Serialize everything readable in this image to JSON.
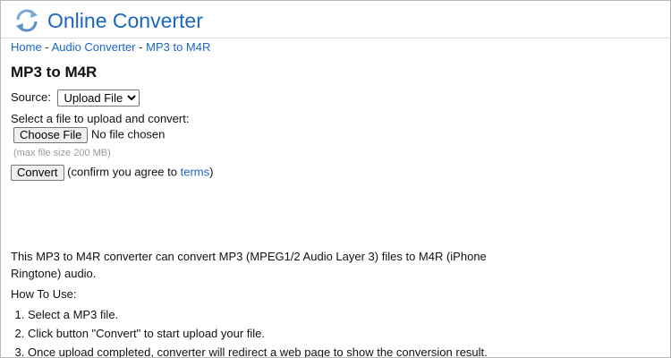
{
  "header": {
    "logo_text": "Online Converter",
    "brand_color": "#2b7fd0",
    "logo_icon": "refresh-arrows-icon"
  },
  "breadcrumb": {
    "items": [
      "Home",
      "Audio Converter",
      "MP3 to M4R"
    ],
    "separator": "-"
  },
  "page": {
    "title": "MP3 to M4R"
  },
  "form": {
    "source_label": "Source:",
    "source_selected": "Upload File",
    "select_prompt": "Select a file to upload and convert:",
    "choose_file_label": "Choose File",
    "no_file_text": "No file chosen",
    "max_size_hint": "(max file size 200 MB)",
    "convert_label": "Convert",
    "confirm_prefix": "(confirm you agree to",
    "terms_link": "terms",
    "confirm_suffix": ")"
  },
  "description": "This MP3 to M4R converter can convert MP3 (MPEG1/2 Audio Layer 3) files to M4R (iPhone Ringtone) audio.",
  "how_to": {
    "title": "How To Use:",
    "steps": [
      "Select a MP3 file.",
      "Click button \"Convert\" to start upload your file.",
      "Once upload completed, converter will redirect a web page to show the conversion result."
    ]
  }
}
